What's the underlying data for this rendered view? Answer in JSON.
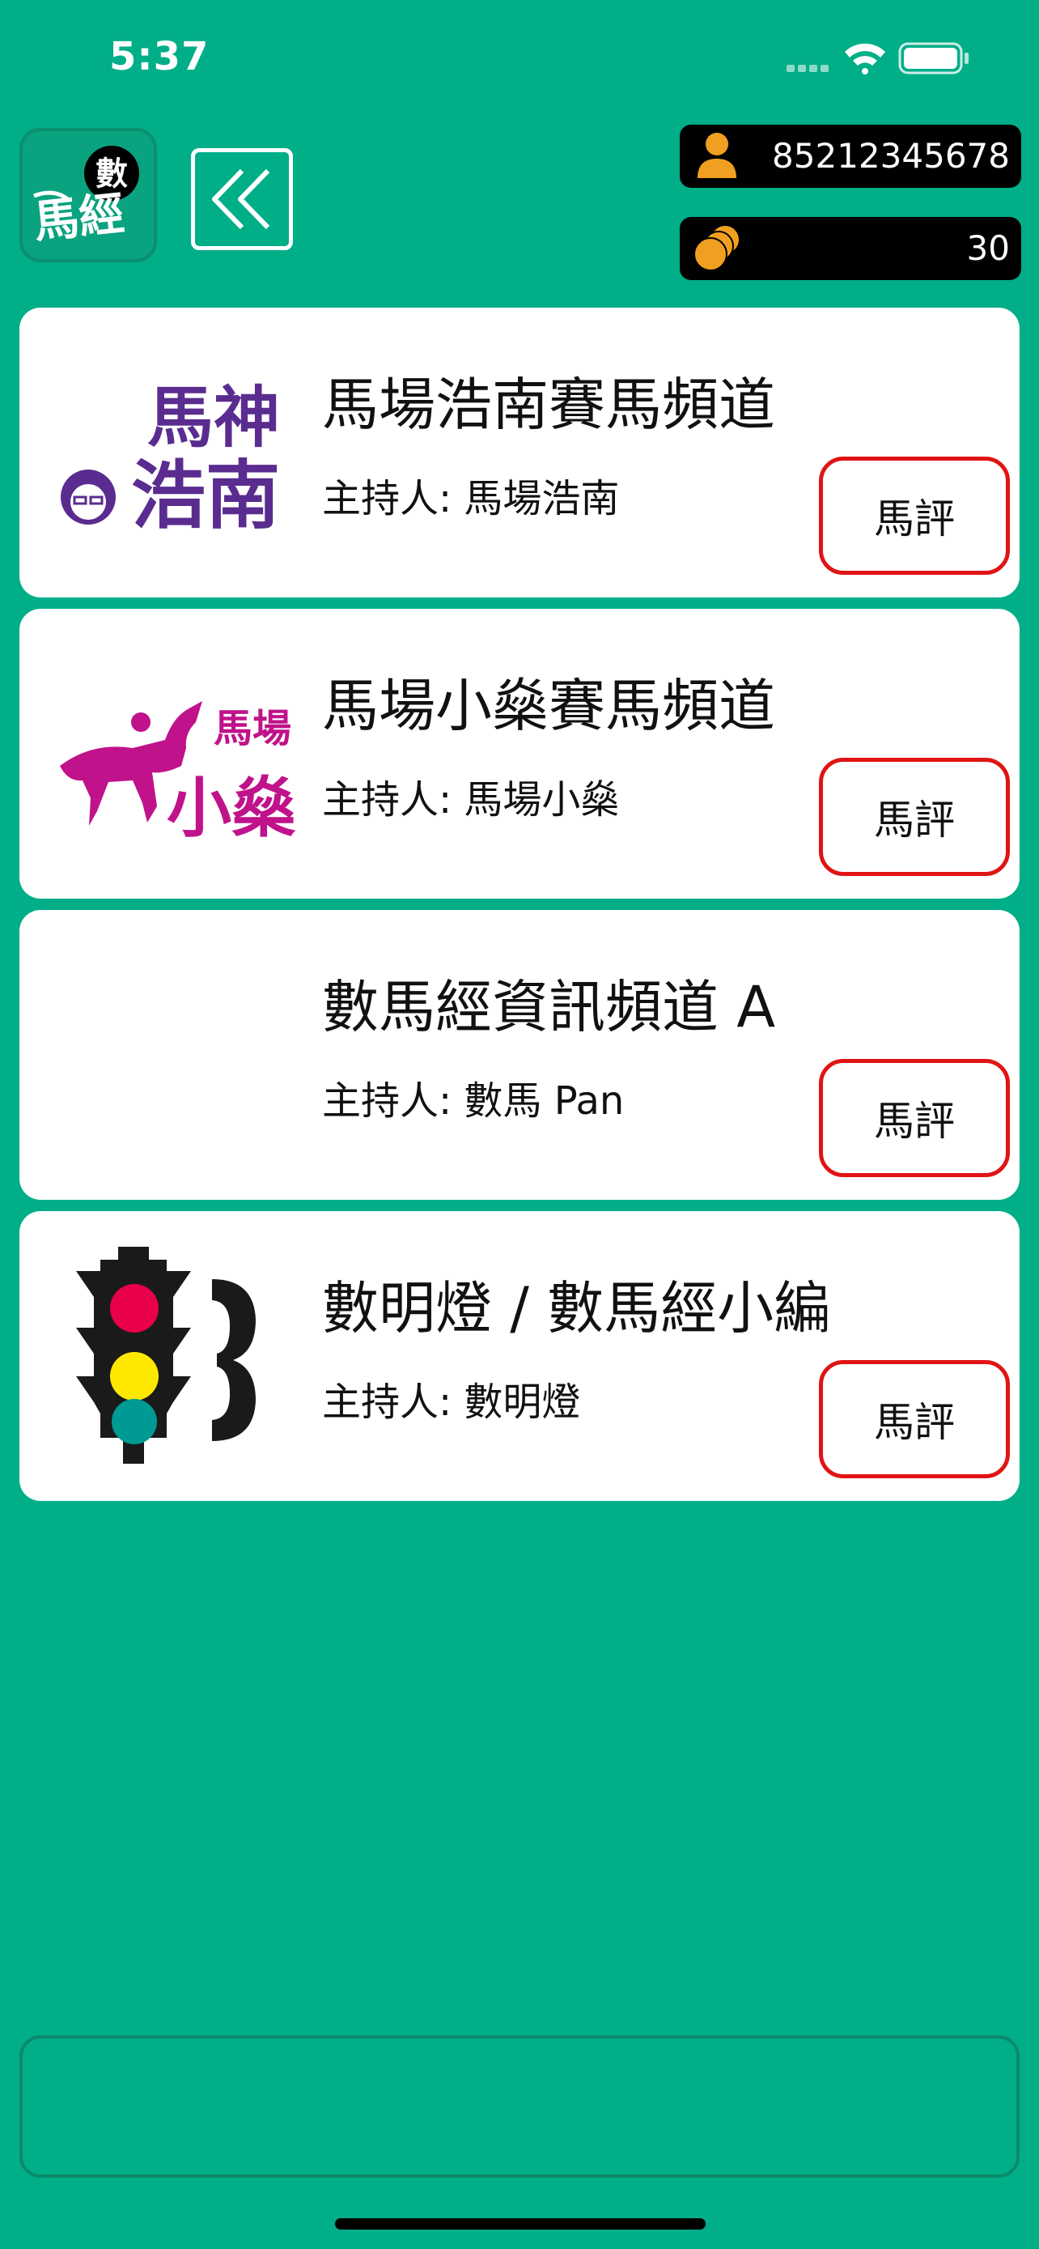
{
  "status_bar": {
    "time": "5:37"
  },
  "header": {
    "logo_text_badge": "數",
    "logo_text_main": "馬經",
    "phone_number": "85212345678",
    "coins": "30"
  },
  "channels": [
    {
      "title": "馬場浩南賽馬頻道",
      "host": "主持人: 馬場浩南",
      "logo_text_top": "馬神",
      "logo_text_bottom": "浩南",
      "button": "馬評"
    },
    {
      "title": "馬場小燊賽馬頻道",
      "host": "主持人: 馬場小燊",
      "logo_text_top": "馬場",
      "logo_text_bottom": "小燊",
      "button": "馬評"
    },
    {
      "title": "數馬經資訊頻道 A",
      "host": "主持人: 數馬 Pan",
      "button": "馬評"
    },
    {
      "title": "數明燈 / 數馬經小編",
      "host": "主持人: 數明燈",
      "button": "馬評"
    }
  ],
  "colors": {
    "background": "#00AE87",
    "button_border": "#e01414",
    "coin": "#F0A020",
    "logo_purple": "#5B2C8F",
    "logo_magenta": "#C0128A"
  }
}
